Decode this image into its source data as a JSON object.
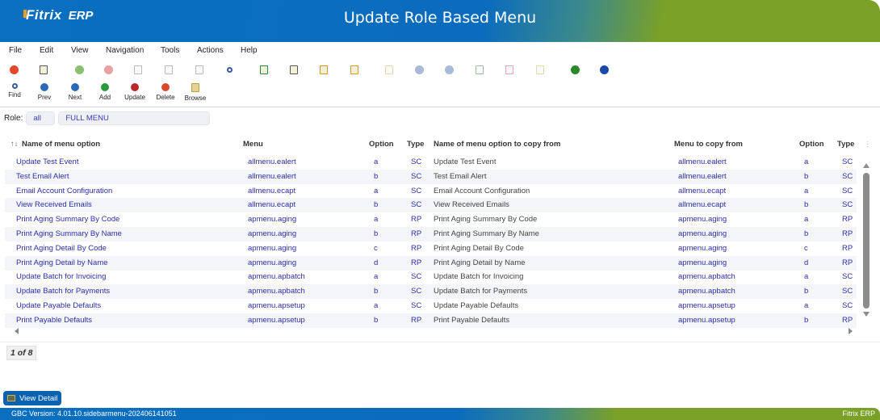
{
  "header": {
    "logo_brand": "Fitrix",
    "logo_suffix": "ERP",
    "title": "Update Role Based Menu"
  },
  "menubar": [
    "File",
    "Edit",
    "View",
    "Navigation",
    "Tools",
    "Actions",
    "Help"
  ],
  "toolbar_icons": [
    {
      "name": "power-icon",
      "color": "#e04a2a",
      "enabled": true
    },
    {
      "name": "copy-window-icon",
      "color": "#555",
      "enabled": true
    },
    {
      "name": "accept-icon",
      "color": "#8cc070",
      "enabled": false
    },
    {
      "name": "cancel-icon",
      "color": "#e8a0a0",
      "enabled": false
    },
    {
      "name": "copy-icon",
      "color": "#bbb",
      "enabled": false
    },
    {
      "name": "paste-icon",
      "color": "#bbb",
      "enabled": false
    },
    {
      "name": "cut-icon",
      "color": "#bbb",
      "enabled": false
    },
    {
      "name": "zoom-icon",
      "color": "#3a5a9a",
      "enabled": true
    },
    {
      "name": "save-icon",
      "color": "#2a8a3a",
      "enabled": true
    },
    {
      "name": "attachment-icon",
      "color": "#555",
      "enabled": true
    },
    {
      "name": "report-icon",
      "color": "#c89a20",
      "enabled": true
    },
    {
      "name": "notes-icon",
      "color": "#c8a030",
      "enabled": true
    },
    {
      "name": "sort-icon",
      "color": "#e0d8b0",
      "enabled": false
    },
    {
      "name": "down-circle-icon",
      "color": "#a8bad8",
      "enabled": false
    },
    {
      "name": "up-circle-icon",
      "color": "#a8bad8",
      "enabled": false
    },
    {
      "name": "chart-icon",
      "color": "#9ac0a0",
      "enabled": false
    },
    {
      "name": "clock-icon",
      "color": "#e8a8b0",
      "enabled": false
    },
    {
      "name": "touch-icon",
      "color": "#e8d8a8",
      "enabled": false
    },
    {
      "name": "forward-icon",
      "color": "#2a8a2a",
      "enabled": true
    },
    {
      "name": "help-icon",
      "color": "#1a4aa8",
      "enabled": true
    }
  ],
  "toolbar_buttons": [
    {
      "name": "find",
      "label": "Find",
      "color": "#3a5a9a"
    },
    {
      "name": "prev",
      "label": "Prev",
      "color": "#2a6ab8"
    },
    {
      "name": "next",
      "label": "Next",
      "color": "#2a6ab8"
    },
    {
      "name": "add",
      "label": "Add",
      "color": "#2a9a3a"
    },
    {
      "name": "update",
      "label": "Update",
      "color": "#b82a2a"
    },
    {
      "name": "delete",
      "label": "Delete",
      "color": "#d84a2a"
    },
    {
      "name": "browse",
      "label": "Browse",
      "color": "#b8a040"
    }
  ],
  "role": {
    "label": "Role:",
    "code": "all",
    "description": "FULL MENU"
  },
  "grid": {
    "sort_indicator": "↑↓",
    "columns": [
      "Name of menu option",
      "Menu",
      "Option",
      "Type",
      "Name of menu option to copy from",
      "Menu to copy from",
      "Option",
      "Type"
    ],
    "rows": [
      [
        "Update Test Event",
        "allmenu.ealert",
        "a",
        "SC",
        "Update Test Event",
        "allmenu.ealert",
        "a",
        "SC"
      ],
      [
        "Test Email Alert",
        "allmenu.ealert",
        "b",
        "SC",
        "Test Email Alert",
        "allmenu.ealert",
        "b",
        "SC"
      ],
      [
        "Email Account Configuration",
        "allmenu.ecapt",
        "a",
        "SC",
        "Email Account Configuration",
        "allmenu.ecapt",
        "a",
        "SC"
      ],
      [
        "View Received Emails",
        "allmenu.ecapt",
        "b",
        "SC",
        "View Received Emails",
        "allmenu.ecapt",
        "b",
        "SC"
      ],
      [
        "Print Aging Summary By Code",
        "apmenu.aging",
        "a",
        "RP",
        "Print Aging Summary By Code",
        "apmenu.aging",
        "a",
        "RP"
      ],
      [
        "Print Aging Summary By Name",
        "apmenu.aging",
        "b",
        "RP",
        "Print Aging Summary By Name",
        "apmenu.aging",
        "b",
        "RP"
      ],
      [
        "Print Aging Detail By Code",
        "apmenu.aging",
        "c",
        "RP",
        "Print Aging Detail By Code",
        "apmenu.aging",
        "c",
        "RP"
      ],
      [
        "Print Aging Detail by Name",
        "apmenu.aging",
        "d",
        "RP",
        "Print Aging Detail by Name",
        "apmenu.aging",
        "d",
        "RP"
      ],
      [
        "Update Batch for Invoicing",
        "apmenu.apbatch",
        "a",
        "SC",
        "Update Batch for Invoicing",
        "apmenu.apbatch",
        "a",
        "SC"
      ],
      [
        "Update Batch for Payments",
        "apmenu.apbatch",
        "b",
        "SC",
        "Update Batch for Payments",
        "apmenu.apbatch",
        "b",
        "SC"
      ],
      [
        "Update Payable Defaults",
        "apmenu.apsetup",
        "a",
        "SC",
        "Update Payable Defaults",
        "apmenu.apsetup",
        "a",
        "SC"
      ],
      [
        "Print Payable Defaults",
        "apmenu.apsetup",
        "b",
        "RP",
        "Print Payable Defaults",
        "apmenu.apsetup",
        "b",
        "RP"
      ]
    ]
  },
  "pager": "1 of 8",
  "view_detail_label": "View Detail",
  "footer": {
    "version": "GBC Version: 4.01.10.sidebarmenu-202406141051",
    "brand": "Fitrix ERP"
  }
}
